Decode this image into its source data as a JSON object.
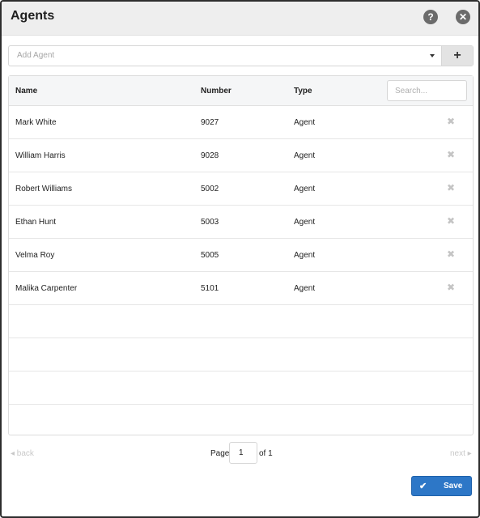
{
  "dialog": {
    "title": "Agents",
    "help_icon": "question-circle-icon",
    "close_icon": "times-circle-icon"
  },
  "add_agent": {
    "placeholder": "Add Agent",
    "button_symbol": "+",
    "dropdown_icon": "caret-down-icon"
  },
  "table": {
    "columns": {
      "name": "Name",
      "number": "Number",
      "type": "Type"
    },
    "search_placeholder": "Search...",
    "delete_icon": "times-icon",
    "delete_symbol": "✖",
    "rows": [
      {
        "name": "Mark White",
        "number": "9027",
        "type": "Agent"
      },
      {
        "name": "William Harris",
        "number": "9028",
        "type": "Agent"
      },
      {
        "name": "Robert Williams",
        "number": "5002",
        "type": "Agent"
      },
      {
        "name": "Ethan Hunt",
        "number": "5003",
        "type": "Agent"
      },
      {
        "name": "Velma Roy",
        "number": "5005",
        "type": "Agent"
      },
      {
        "name": "Malika Carpenter",
        "number": "5101",
        "type": "Agent"
      }
    ]
  },
  "pagination": {
    "back_label": "◂ back",
    "next_label": "next ▸",
    "page_label": "Page",
    "current_page": "1",
    "of_label": "of 1"
  },
  "footer": {
    "save_label": "Save",
    "save_check": "✔"
  },
  "colors": {
    "header_bg": "#eeeeee",
    "accent": "#2d77c7",
    "muted": "#c9c9c9"
  }
}
